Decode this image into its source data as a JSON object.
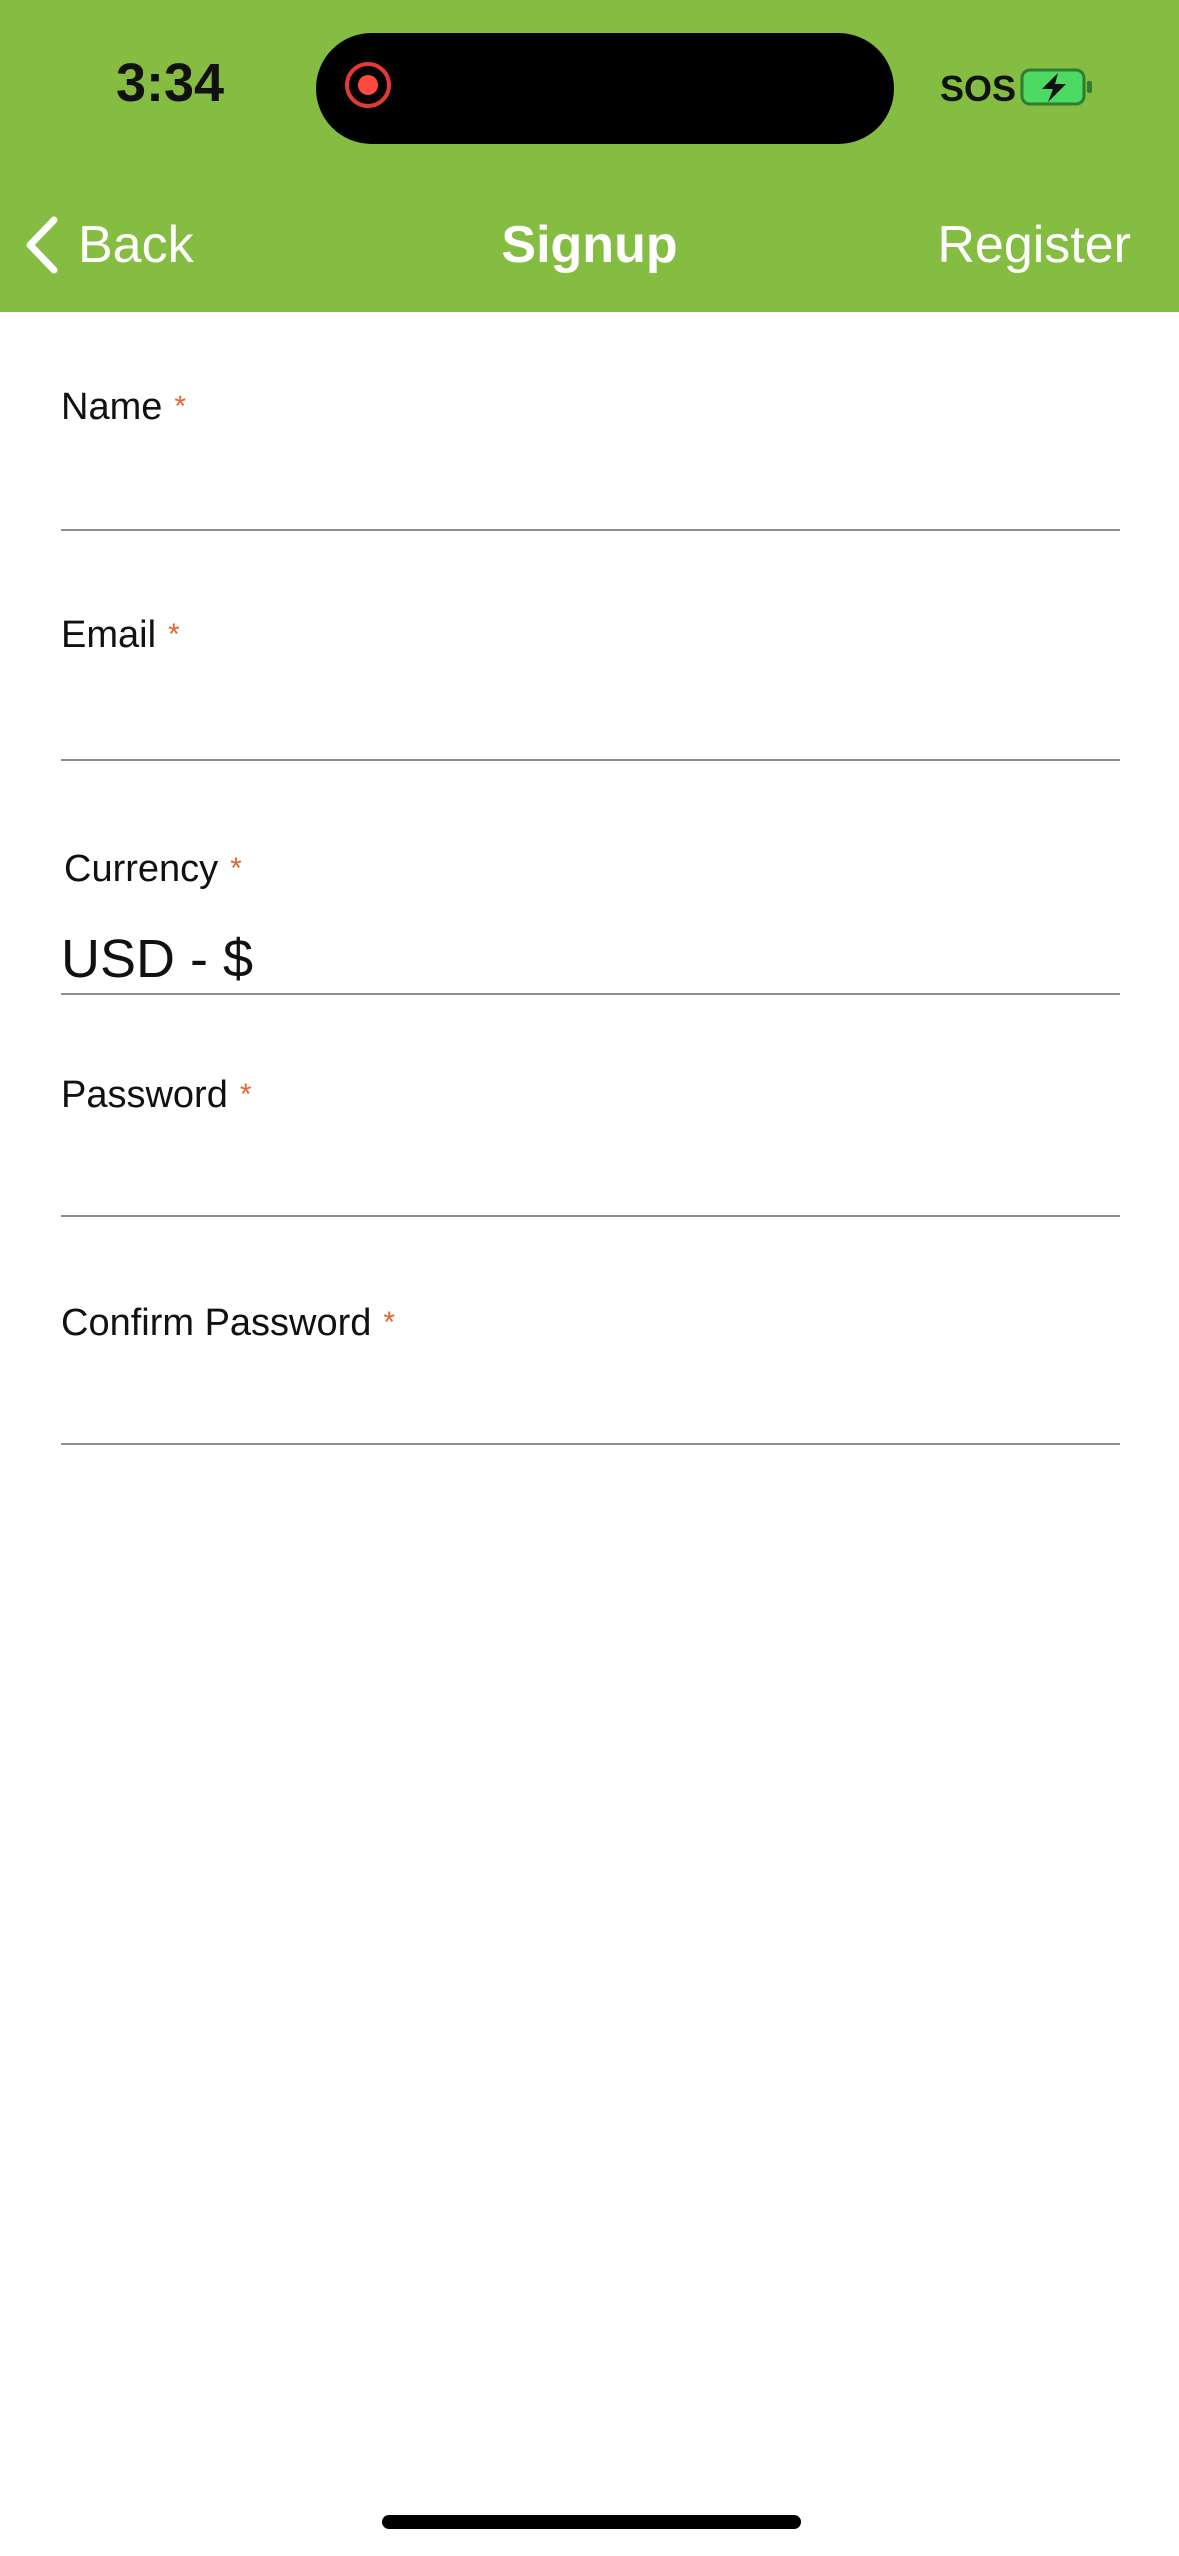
{
  "status_bar": {
    "time": "3:34",
    "sos": "SOS",
    "battery_charging": true,
    "recording_indicator": true
  },
  "nav": {
    "back_label": "Back",
    "title": "Signup",
    "register_label": "Register"
  },
  "form": {
    "required_mark": "*",
    "required_color": "#e8652e",
    "name": {
      "label": "Name",
      "value": ""
    },
    "email": {
      "label": "Email",
      "value": ""
    },
    "currency": {
      "label": "Currency",
      "value": "USD - $"
    },
    "password": {
      "label": "Password",
      "value": ""
    },
    "confirm_password": {
      "label": "Confirm Password",
      "value": ""
    }
  },
  "colors": {
    "header_bg": "#84bd42",
    "header_text": "#ffffff"
  },
  "icons": [
    "chevron-left-icon",
    "record-icon",
    "battery-charging-icon"
  ]
}
